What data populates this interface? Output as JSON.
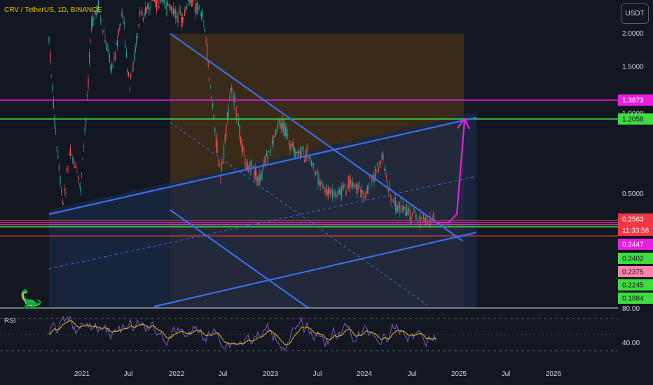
{
  "header": {
    "symbol_title": "CRV / TetherUS, 1D, BINANCE",
    "currency_button": "USDT"
  },
  "colors": {
    "background": "#131722",
    "up_candle": "#26a69a",
    "down_candle": "#ef5350",
    "channel_line": "#3a6ee8",
    "magenta_line": "#e91ee0",
    "green_line": "#3fdc3f",
    "red_line": "#d83a3a",
    "pink_line": "#ff82c8",
    "rsi_line": "#7e57c2",
    "rsi_ma": "#e3c000",
    "text": "#d1d4dc"
  },
  "chart_data": {
    "type": "candlestick",
    "symbol": "CRV / TetherUS",
    "interval": "1D",
    "exchange": "BINANCE",
    "y_scale": "log",
    "y_axis_ticks": [
      "2.0000",
      "1.5000",
      "1.0000",
      "0.5000"
    ],
    "x_axis_ticks": [
      "2021",
      "Jul",
      "2022",
      "Jul",
      "2023",
      "Jul",
      "2024",
      "Jul",
      "2025",
      "Jul",
      "2026"
    ],
    "price_levels": [
      {
        "label": "1.3873",
        "value": 1.3873,
        "color": "#e91ee0"
      },
      {
        "label": "1.2058",
        "value": 1.2058,
        "color": "#3fdc3f"
      },
      {
        "label": "0.2563",
        "value": 0.2563,
        "color": "#f23645"
      },
      {
        "label": "11:33:58",
        "color": "#f23645"
      },
      {
        "label": "0.2447",
        "value": 0.2447,
        "color": "#e91ee0"
      },
      {
        "label": "0.2402",
        "value": 0.2402,
        "color": "#3fdc3f"
      },
      {
        "label": "0.2375",
        "value": 0.2375,
        "color": "#ff82a8"
      },
      {
        "label": "0.2245",
        "value": 0.2245,
        "color": "#3fdc3f"
      },
      {
        "label": "0.1884",
        "value": 0.1884,
        "color": "#3fdc3f"
      }
    ],
    "rsi": {
      "label": "RSI",
      "upper_tick": "80.00",
      "lower_tick": "40.00"
    }
  }
}
